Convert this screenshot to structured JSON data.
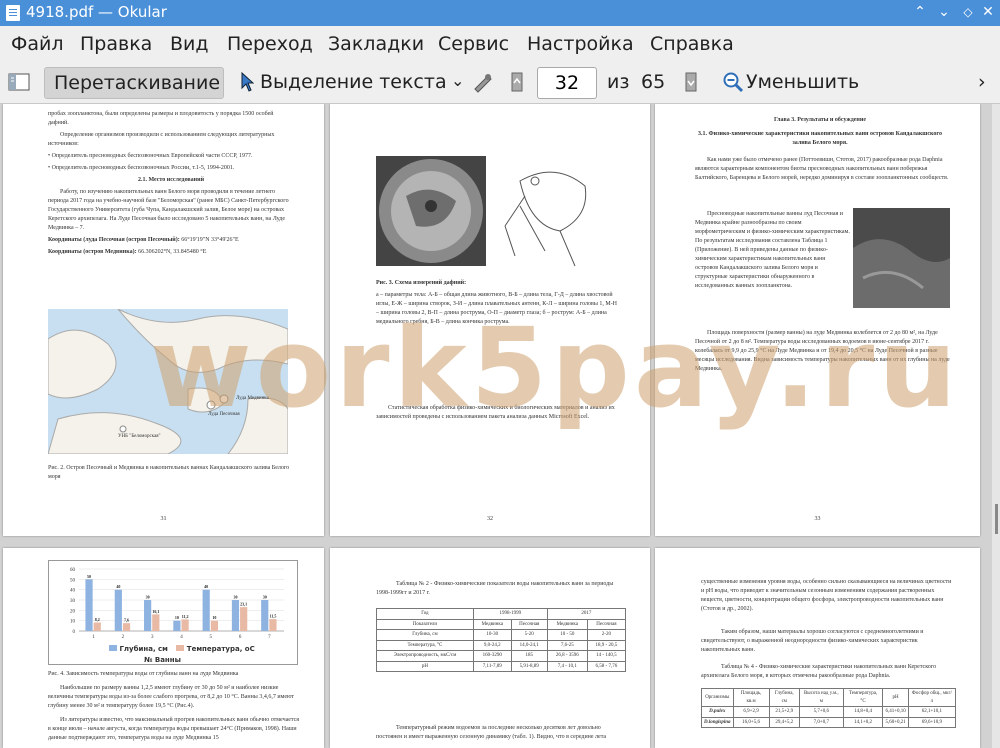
{
  "window": {
    "title": "4918.pdf  — Okular"
  },
  "menu": [
    "Файл",
    "Правка",
    "Вид",
    "Переход",
    "Закладки",
    "Сервис",
    "Настройка",
    "Справка"
  ],
  "toolbar": {
    "drag_label": "Перетаскивание",
    "select_label": "Выделение текста",
    "page_value": "32",
    "of_label": "из",
    "total_pages": "65",
    "zoom_out_label": "Уменьшить"
  },
  "pages": {
    "p31": {
      "intro": "пробах зоопланктона, были определены размеры и плодовитость у порядка 1500 особей дафний.",
      "sources_title": "Определение организмов производили с использованием следующих литературных источников:",
      "bullets": [
        "Определитель пресноводных беспозвоночных Европейской части СССР, 1977.",
        "Определитель пресноводных беспозвоночных России, т.1-5, 1994-2001."
      ],
      "heading": "2.1. Место исследований",
      "body": "Работу, по изучению накопительных ванн Белого моря проводили в течение летнего периода 2017 года на учебно-научной базе \"Беломорская\" (ранее МБС) Санкт-Петербургского Государственного Университета (губа Чупа, Кандалакшский залив, Белое море) на островах Керетского архипелага. На Луде Песочная было исследовано 5 накопительных ванн, на Луде Медвинка – 7.",
      "coords_title1": "Координаты (луда Песочная (остров Песочный):",
      "coords1": "66°19'19\"N 33°49'26\"E",
      "coords_title2": "Координаты (остров Медвинка):",
      "coords2": "66.306202°N, 33.845480 °E",
      "map_label1": "Луда Медвинка",
      "map_label2": "Луда Песочная",
      "map_label3": "УНБ \"Беломорская\"",
      "caption": "Рис. 2. Остров Песочный и Медвинка в накопительных ваннах Кандалакшского залива Белого моря",
      "num": "31"
    },
    "p32": {
      "caption": "Рис. 3. Схема измерений дафний:",
      "legend": "а – параметры тела: А-Б – общая длина животного, В-Б – длина тела, Г-Д – длина хвостовой иглы, Е-Ж – ширина створок, З-И – длина плавательных антенн, К-Л – ширина головы 1, М-Н – ширина головы 2, В-П – длина рострума, О-П – диаметр глаза; б – рострум: А-Б – длина медиального гребня, Б-В – длина кончика рострума.",
      "note": "Статистическая обработка физико-химических и биологических материалов и анализ их зависимостей проведены с использованием пакета анализа данных Microsoft Excel.",
      "num": "32"
    },
    "p33": {
      "chapter": "Глава 3. Результаты и обсуждение",
      "section": "3.1. Физико-химические характеристики накопительных ванн островов Кандалакшского залива Белого моря.",
      "para1": "Как нами уже было отмечено ранее (Поттоевишн, Стотов, 2017) ракообразные рода Daphnia являются характерным компонентом биоты пресноводных накопительных ванн побережья Балтийского, Баренцева и Белого морей, нередко доминируя в составе зоопланктонных сообществ.",
      "para2": "Пресноводные накопительные ванны луд Песочная и Медвинка крайне разнообразны по своим морфометрическим и физико-химическим характеристикам. По результатам исследования составлена Таблица 1 (Приложение). В ней приведены данные по физико-химическим характеристикам накопительных ванн островов Кандалакшского залива Белого моря и структурные характеристики обнаруженного в исследованных ванных зоопланктона.",
      "para3": "Площадь поверхности (размер ванны) на луде Медвинка колеблется от 2 до 80 м², на Луде Песочной от 2 до 8 м². Температура воды исследованных водоемов в июне-сентябре 2017 г. колебалась от 9,9 до 25,9 °С на Луде Медвинка и от 19,4 до 20,5 °С на Луде Песочной в разные месяцы исследования. Видна зависимость температуры накопительных ванн от их глубины на луде Медвинка.",
      "num": "33"
    },
    "p34": {
      "legend1": "Глубина, см",
      "legend2": "Температура, оС",
      "xtitle": "№ Ванны",
      "caption": "Рис. 4. Зависимость температуры воды от глубины ванн на луде Медвинка",
      "para1": "Наибольшие по размеру ванны 1,2,5 имеют глубину от 30 до 50 м² и наиболее низкие величины температуры воды из-за более слабого прогрева, от 8,2 до 10 °С. Ванны 3,4,6,7 имеют глубину менее 30 м² и температуру более 19,5 °С (Рис.4).",
      "para2": "Из литературы известно, что максимальный прогрев накопительных ванн обычно отмечается в конце июля – начале августа, когда температура воды превышает 24°С (Примаков, 1998). Наши данные подтверждают это, температура воды на луде Медвинка 15"
    },
    "p35": {
      "table_title": "Таблица № 2 - Физико-химические показатели воды накопительных ванн за периоды 1998-1999гг и 2017 г.",
      "head_year": "Год",
      "head_p1": "1998-1999",
      "head_p2": "2017",
      "head_param": "Показатели",
      "head_cols": [
        "Медвинка",
        "Песочная",
        "Медвинка",
        "Песочная"
      ],
      "rows": [
        {
          "name": "Глубина, см",
          "v": [
            "10-30",
            "5-20",
            "10 - 50",
            "2-20"
          ]
        },
        {
          "name": "Температура, °С",
          "v": [
            "9,0-24,2",
            "14,0-24,1",
            "7,6-25",
            "18,9 - 20,5"
          ]
        },
        {
          "name": "Электропроводность, мкС/см",
          "v": [
            "160-3290",
            "185",
            "26,8 - 3596",
            "14 - 140,5"
          ]
        },
        {
          "name": "pH",
          "v": [
            "7,11-7,89",
            "5,91-8,89",
            "7,4 - 10,1",
            "6,58 - 7,76"
          ]
        }
      ],
      "after": "Температурный режим водоемов за последние несколько десятков лет довольно постоянен и имеет выраженную сезонную динамику (табл. 1). Видно, что в середине лета"
    },
    "p36": {
      "para1": "существенные изменения уровня воды, особенно сильно сказывающиеся на величинах цветности и pH воды, что приводит к значительным сезонным изменениям содержания растворенных веществ, цветности, концентрации общего фосфора, электропроводности накопительных ванн (Стотов и др., 2002).",
      "para2": "Таким образом, наши материалы хорошо согласуются с среднемноголетними и свидетельствуют, о выраженной неоднородности физико-химических характеристик накопительных ванн.",
      "table_title": "Таблица № 4 - Физико-химические характеристики накопительных ванн Керетского архипелага Белого моря, в которых отмечены ракообразные рода Daphnia.",
      "head": [
        "Организмы",
        "Площадь, кв.м",
        "Глубина, см",
        "Высота над у.м., м",
        "Температура, °С",
        "pH",
        "Фосфор общ., мкг/л"
      ],
      "rows": [
        {
          "name": "D.pulex",
          "v": [
            "6,9+2,9",
            "21,5+2,9",
            "5,7+0,6",
            "14,8+0,4",
            "6,41+0,10",
            "62,1+10,1"
          ]
        },
        {
          "name": "D.longispina",
          "v": [
            "16,0+5,6",
            "29,4+5,2",
            "7,0+0,7",
            "14,1+0,2",
            "5,60+0,21",
            "69,6+10,9"
          ]
        }
      ]
    }
  },
  "chart_data": {
    "type": "bar",
    "categories": [
      "1",
      "2",
      "3",
      "4",
      "5",
      "6",
      "7"
    ],
    "series": [
      {
        "name": "Глубина, см",
        "values": [
          50,
          40,
          30,
          10,
          40,
          30,
          30
        ]
      },
      {
        "name": "Температура, оС",
        "values": [
          8.2,
          7.6,
          16.1,
          11.2,
          10.0,
          23.1,
          11.5
        ]
      }
    ],
    "ylim": [
      0,
      60
    ],
    "yticks": [
      0,
      10,
      20,
      30,
      40,
      50,
      60
    ],
    "xlabel": "№ Ванны",
    "legend": "bottom",
    "colors": [
      "#8fb3e0",
      "#e8b9a5"
    ]
  }
}
